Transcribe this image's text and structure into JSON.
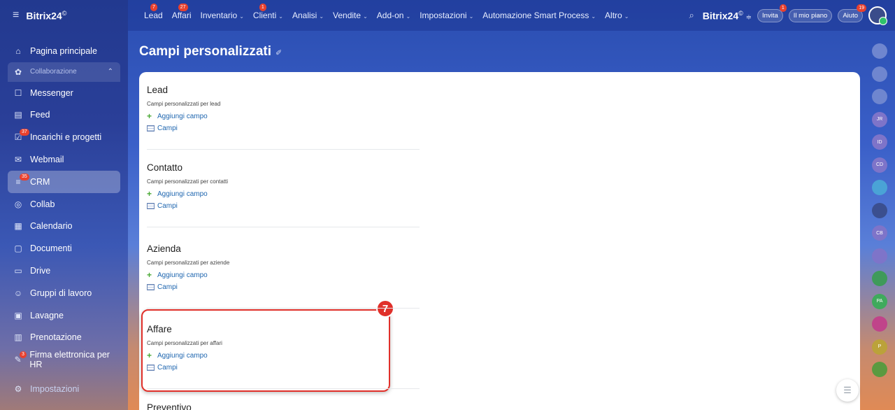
{
  "sidebar": {
    "logo": "Bitrix24",
    "logo_mark": "©",
    "items": [
      {
        "label": "Pagina principale",
        "icon": "home-icon",
        "glyph": "⌂"
      },
      {
        "label": "Collaborazione",
        "icon": "collab-group-icon",
        "glyph": "✿",
        "group": true
      },
      {
        "label": "Messenger",
        "icon": "messenger-icon",
        "glyph": "☐"
      },
      {
        "label": "Feed",
        "icon": "feed-icon",
        "glyph": "▤"
      },
      {
        "label": "Incarichi e progetti",
        "icon": "tasks-icon",
        "glyph": "☑",
        "badge": "37"
      },
      {
        "label": "Webmail",
        "icon": "mail-icon",
        "glyph": "✉"
      },
      {
        "label": "CRM",
        "icon": "crm-icon",
        "glyph": "≡",
        "badge": "35",
        "active": true
      },
      {
        "label": "Collab",
        "icon": "collab-icon",
        "glyph": "◎"
      },
      {
        "label": "Calendario",
        "icon": "calendar-icon",
        "glyph": "▦"
      },
      {
        "label": "Documenti",
        "icon": "documents-icon",
        "glyph": "▢"
      },
      {
        "label": "Drive",
        "icon": "drive-icon",
        "glyph": "▭"
      },
      {
        "label": "Gruppi di lavoro",
        "icon": "groups-icon",
        "glyph": "☺"
      },
      {
        "label": "Lavagne",
        "icon": "boards-icon",
        "glyph": "▣"
      },
      {
        "label": "Prenotazione",
        "icon": "booking-icon",
        "glyph": "▥"
      },
      {
        "label": "Firma elettronica per HR",
        "icon": "signature-icon",
        "glyph": "✎",
        "badge": "3"
      },
      {
        "label": "Impostazioni",
        "icon": "settings-icon",
        "glyph": "⚙"
      }
    ]
  },
  "topbar": {
    "menu": [
      {
        "label": "Lead",
        "badge": "7",
        "caret": false
      },
      {
        "label": "Affari",
        "badge": "27",
        "caret": false
      },
      {
        "label": "Inventario",
        "caret": true
      },
      {
        "label": "Clienti",
        "badge": "1",
        "caret": true
      },
      {
        "label": "Analisi",
        "caret": true
      },
      {
        "label": "Vendite",
        "caret": true
      },
      {
        "label": "Add-on",
        "caret": true
      },
      {
        "label": "Impostazioni",
        "caret": true
      },
      {
        "label": "Automazione Smart Process",
        "caret": true
      },
      {
        "label": "Altro",
        "caret": true
      }
    ],
    "brand": "Bitrix24",
    "invite": {
      "label": "Invita",
      "badge": "1"
    },
    "plan": "Il mio piano",
    "help": {
      "label": "Aiuto",
      "badge": "19"
    }
  },
  "page": {
    "title": "Campi personalizzati",
    "sections": [
      {
        "title": "Lead",
        "desc": "Campi personalizzati per lead",
        "add": "Aggiungi campo",
        "fields": "Campi"
      },
      {
        "title": "Contatto",
        "desc": "Campi personalizzati per contatti",
        "add": "Aggiungi campo",
        "fields": "Campi"
      },
      {
        "title": "Azienda",
        "desc": "Campi personalizzati per aziende",
        "add": "Aggiungi campo",
        "fields": "Campi"
      },
      {
        "title": "Affare",
        "desc": "Campi personalizzati per affari",
        "add": "Aggiungi campo",
        "fields": "Campi"
      },
      {
        "title": "Preventivo",
        "desc": "",
        "add": "",
        "fields": ""
      }
    ],
    "step_marker": "7"
  },
  "rail": [
    {
      "label": "",
      "color": "#6f86cf"
    },
    {
      "label": "",
      "color": "#6f86cf"
    },
    {
      "label": "",
      "color": "#6f86cf"
    },
    {
      "label": "JR",
      "color": "#7e74c9"
    },
    {
      "label": "ID",
      "color": "#7e74c9"
    },
    {
      "label": "CD",
      "color": "#7e74c9"
    },
    {
      "label": "",
      "color": "#4aa3d6"
    },
    {
      "label": "",
      "color": "#3b4f8f"
    },
    {
      "label": "CB",
      "color": "#7e74c9"
    },
    {
      "label": "",
      "color": "#7e74c9"
    },
    {
      "label": "",
      "color": "#3f9a5a"
    },
    {
      "label": "PA",
      "color": "#3faa5c"
    },
    {
      "label": "",
      "color": "#c0448a"
    },
    {
      "label": "P",
      "color": "#bba23a"
    },
    {
      "label": "",
      "color": "#5a9a40"
    }
  ]
}
